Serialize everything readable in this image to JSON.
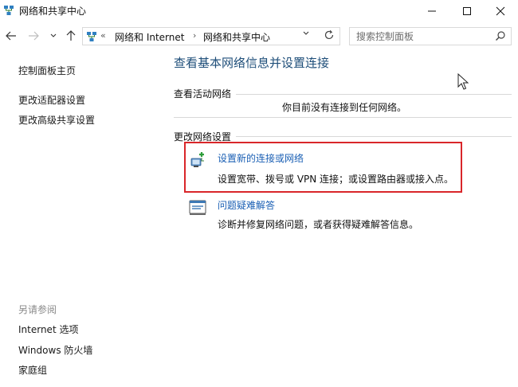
{
  "window": {
    "title": "网络和共享中心"
  },
  "address": {
    "overflow": "«",
    "crumbs": [
      "网络和 Internet",
      "网络和共享中心"
    ],
    "separator": "›",
    "search_placeholder": "搜索控制面板"
  },
  "sidebar": {
    "home": "控制面板主页",
    "links": [
      "更改适配器设置",
      "更改高级共享设置"
    ],
    "see_also_title": "另请参阅",
    "see_also": [
      "Internet 选项",
      "Windows 防火墙",
      "家庭组"
    ]
  },
  "main": {
    "heading": "查看基本网络信息并设置连接",
    "active_section": "查看活动网络",
    "no_connection": "你目前没有连接到任何网络。",
    "change_section": "更改网络设置",
    "tasks": [
      {
        "link": "设置新的连接或网络",
        "desc": "设置宽带、拨号或 VPN 连接；或设置路由器或接入点。",
        "icon": "new-connection-icon"
      },
      {
        "link": "问题疑难解答",
        "desc": "诊断并修复网络问题，或者获得疑难解答信息。",
        "icon": "troubleshoot-icon"
      }
    ]
  },
  "colors": {
    "heading": "#1e4e79",
    "link": "#1a5fb4",
    "highlight": "#d9262a"
  }
}
